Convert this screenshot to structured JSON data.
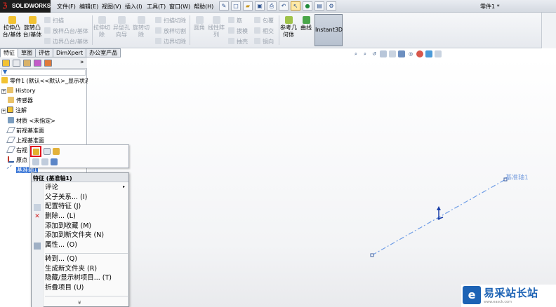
{
  "app": {
    "logo": "SOLIDWORKS",
    "document_title": "零件1 *"
  },
  "menu": [
    "文件(F)",
    "编辑(E)",
    "视图(V)",
    "插入(I)",
    "工具(T)",
    "窗口(W)",
    "帮助(H)"
  ],
  "ribbon": {
    "extrude_boss": "拉伸凸台/基体",
    "revolve_boss": "旋转凸台/基体",
    "sweep": "扫描",
    "loft_boss": "放样凸台/基体",
    "boundary_boss": "边界凸台/基体",
    "extrude_cut": "拉伸切除",
    "hole_wizard": "异型孔向导",
    "revolve_cut": "旋转切除",
    "sweep_cut": "扫描切除",
    "loft_cut": "放样切割",
    "boundary_cut": "边界切除",
    "fillet": "圆角",
    "linear_pattern": "线性阵列",
    "rib": "筋",
    "draft": "拔模",
    "shell": "抽壳",
    "wrap": "包覆",
    "intersect": "相交",
    "mirror": "镜向",
    "ref_geometry": "参考几何体",
    "curves": "曲线",
    "instant3d": "Instant3D"
  },
  "tabs": [
    "特征",
    "草图",
    "评估",
    "DimXpert",
    "办公室产品"
  ],
  "tree": {
    "root": "零件1 (默认<<默认>_显示状态",
    "items": [
      "History",
      "传感器",
      "注解",
      "材质 <未指定>",
      "前视基准面",
      "上视基准面",
      "右视",
      "原点",
      "基准轴1"
    ]
  },
  "context_menu": {
    "header": "特征 (基准轴1)",
    "items": [
      "评论",
      "父子关系... (I)",
      "配置特征 (J)",
      "删除... (L)",
      "添加到收藏 (M)",
      "添加到新文件夹 (N)",
      "属性... (O)",
      "转到... (Q)",
      "生成新文件夹 (R)",
      "隐藏/显示树项目... (T)",
      "折叠项目 (U)"
    ],
    "more": "¥"
  },
  "graphics": {
    "axis_label": "基准轴1",
    "axis_color": "#6f9de6"
  },
  "watermark": {
    "text": "易采站长站",
    "url": "www.easck.com"
  }
}
